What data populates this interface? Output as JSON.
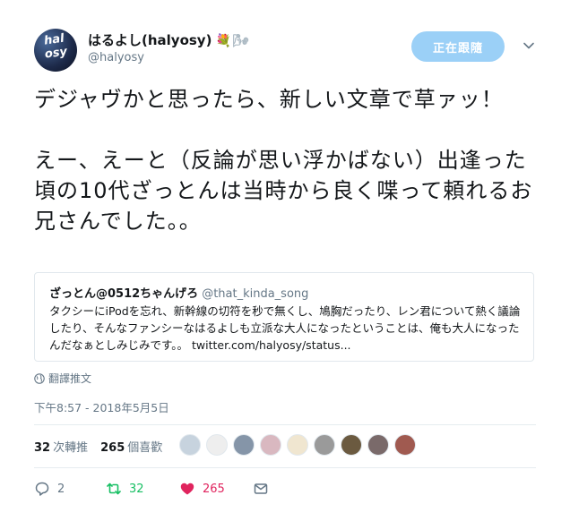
{
  "author": {
    "display_name": "はるよし(halyosy)",
    "handle": "@halyosy",
    "avatar_text_line1": "hal",
    "avatar_text_line2": "osy",
    "emoji_1": "💐",
    "emoji_2": "🌬"
  },
  "follow_button": {
    "label": "正在跟隨"
  },
  "tweet": {
    "text": "デジャヴかと思ったら、新しい文章で草ァッ！\n\nえー、えーと（反論が思い浮かばない）出逢った頃の10代ざっとんは当時から良く喋って頼れるお兄さんでした。。"
  },
  "quoted_tweet": {
    "name": "ざっとん@0512ちゃんげろ",
    "handle": "@that_kinda_song",
    "text": "タクシーにiPodを忘れ、新幹線の切符を秒で無くし、鳩胸だったり、レン君について熱く議論したり、そんなファンシーなはるよしも立派な大人になったということは、俺も大人になったんだなぁとしみじみです。。",
    "link": "twitter.com/halyosy/status..."
  },
  "translate_label": "翻譯推文",
  "timestamp": "下午8:57 - 2018年5月5日",
  "stats": {
    "retweets_count": "32",
    "retweets_label": "次轉推",
    "likes_count": "265",
    "likes_label": "個喜歡"
  },
  "liker_avatar_colors": [
    "#c7d3de",
    "#eeeeee",
    "#8595a8",
    "#d9b8c0",
    "#f0e6d0",
    "#9a9a9a",
    "#6b5a40",
    "#7a6a6a",
    "#a05a50"
  ],
  "actions": {
    "reply_count": "2",
    "retweet_count": "32",
    "like_count": "265"
  },
  "colors": {
    "follow_button_bg": "#9bd0f7",
    "retweet_green": "#17bf63",
    "like_red": "#e0245e",
    "muted_gray": "#657786"
  }
}
